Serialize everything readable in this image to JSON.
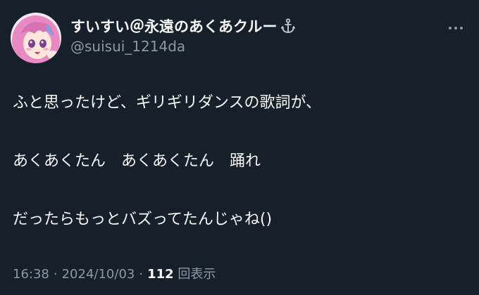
{
  "user": {
    "display_name": "すいすい＠永遠のあくあクルー",
    "handle": "@suisui_1214da",
    "badge_icon": "anchor-icon",
    "avatar": "avatar-anime-girl"
  },
  "tweet": {
    "lines": [
      "ふと思ったけど、ギリギリダンスの歌詞が、",
      "あくあくたん　あくあくたん　踊れ",
      "だったらもっとバズってたんじゃね()"
    ]
  },
  "meta": {
    "time": "16:38",
    "separator": "·",
    "date": "2024/10/03",
    "views_count": "112",
    "views_label": "回表示"
  },
  "colors": {
    "background": "#15202b",
    "text": "#f7f9f9",
    "secondary": "#8b98a5",
    "avatar_hair": "#e889c4"
  },
  "icons": {
    "more": "more-horizontal-icon"
  }
}
